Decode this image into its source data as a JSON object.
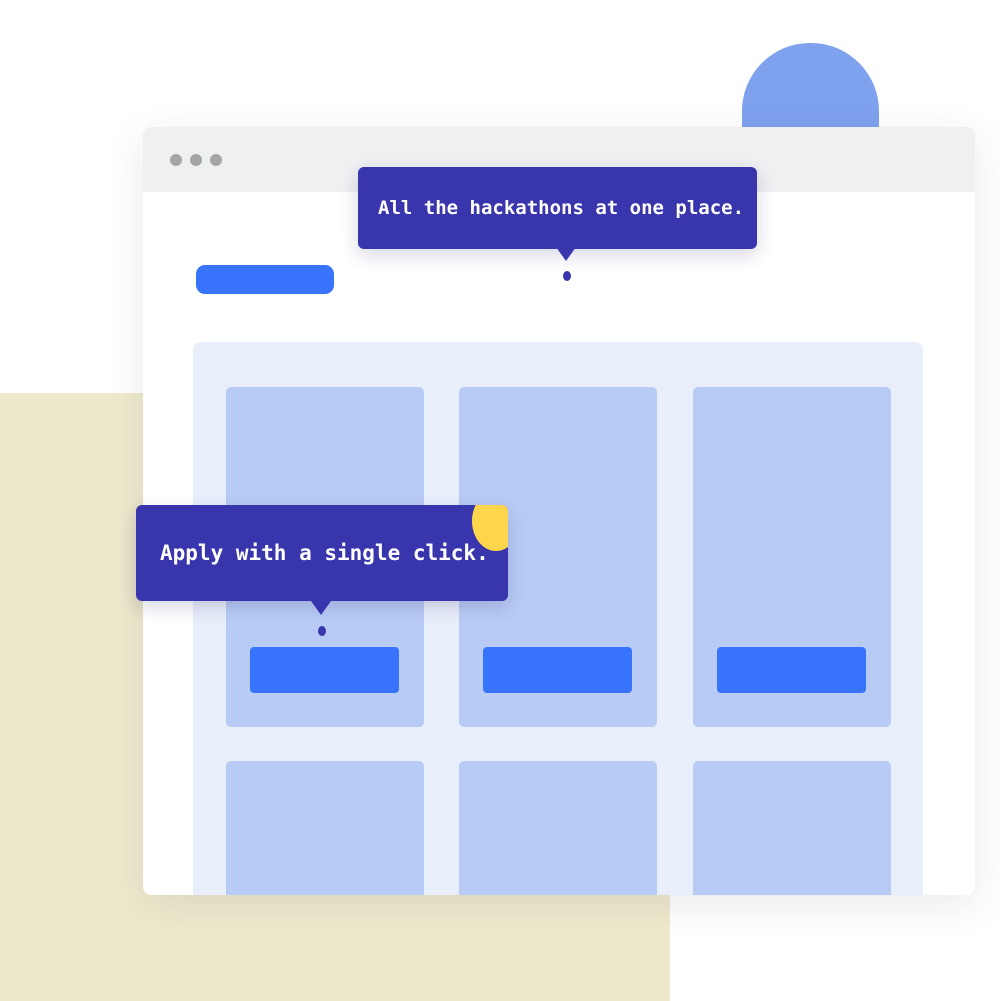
{
  "tooltips": {
    "top_text": "All the hackathons at one place.",
    "left_text": "Apply with a single click."
  },
  "colors": {
    "tooltip_bg": "#3935ad",
    "primary_blue": "#3874fb",
    "card_bg": "#b8cbf5",
    "panel_bg": "#e9eefb",
    "accent_yellow": "#fed64b",
    "beige_bg": "#efe9cc",
    "blob_blue": "#7fa2ee"
  },
  "window": {
    "controls": [
      "window-dot",
      "window-dot",
      "window-dot"
    ]
  }
}
